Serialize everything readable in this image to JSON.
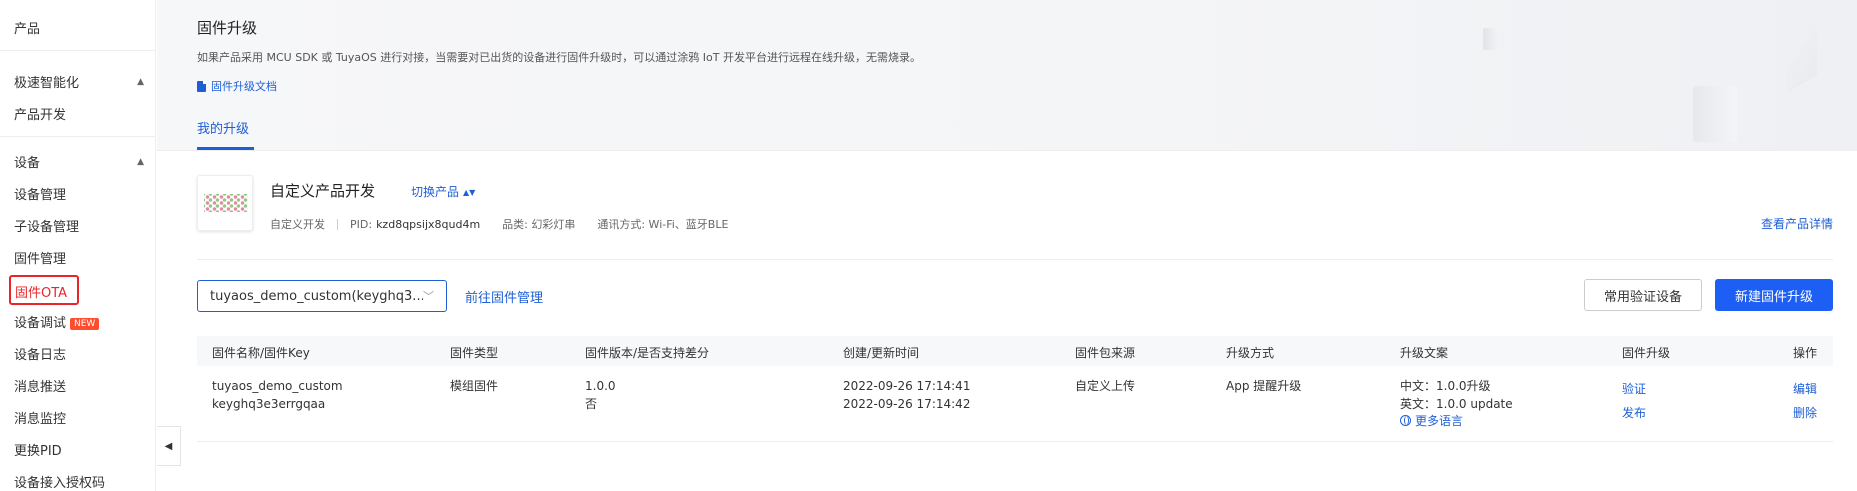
{
  "sidebar": {
    "top_item": "产品",
    "group1": {
      "label": "极速智能化",
      "items": [
        "产品开发"
      ]
    },
    "group2": {
      "label": "设备",
      "items": [
        "设备管理",
        "子设备管理",
        "固件管理",
        "固件OTA",
        "设备调试",
        "设备日志",
        "消息推送",
        "消息监控",
        "更换PID",
        "设备接入授权码"
      ]
    },
    "new_badge": "NEW"
  },
  "header": {
    "title": "固件升级",
    "description": "如果产品采用 MCU SDK 或 TuyaOS 进行对接，当需要对已出货的设备进行固件升级时，可以通过涂鸦 IoT 开发平台进行远程在线升级，无需烧录。",
    "doc_link": "固件升级文档",
    "tab": "我的升级"
  },
  "product": {
    "name": "自定义产品开发",
    "switch_label": "切换产品",
    "type": "自定义开发",
    "pid_label": "PID:",
    "pid": "kzd8qpsijx8qud4m",
    "category": "品类: 幻彩灯串",
    "comm": "通讯方式: Wi-Fi、蓝牙BLE",
    "view_detail": "查看产品详情"
  },
  "toolbar": {
    "firmware_select": "tuyaos_demo_custom(keyghq3...",
    "goto_fw_mgmt": "前往固件管理",
    "verify_devices": "常用验证设备",
    "new_upgrade": "新建固件升级"
  },
  "table": {
    "headers": [
      "固件名称/固件Key",
      "固件类型",
      "固件版本/是否支持差分",
      "创建/更新时间",
      "固件包来源",
      "升级方式",
      "升级文案",
      "固件升级",
      "操作"
    ],
    "rows": [
      {
        "name": "tuyaos_demo_custom",
        "key": "keyghq3e3errgqaa",
        "type": "模组固件",
        "version": "1.0.0",
        "diff": "否",
        "created": "2022-09-26 17:14:41",
        "updated": "2022-09-26 17:14:42",
        "source": "自定义上传",
        "method": "App 提醒升级",
        "text_cn": "中文：1.0.0升级",
        "text_en": "英文：1.0.0 update",
        "more_lang": "更多语言",
        "upgrade_verify": "验证",
        "upgrade_publish": "发布",
        "op_edit": "编辑",
        "op_delete": "删除"
      }
    ]
  },
  "colors": {
    "accent": "#1d5ef5",
    "link": "#1f5fd6",
    "highlight": "#e8262a"
  }
}
